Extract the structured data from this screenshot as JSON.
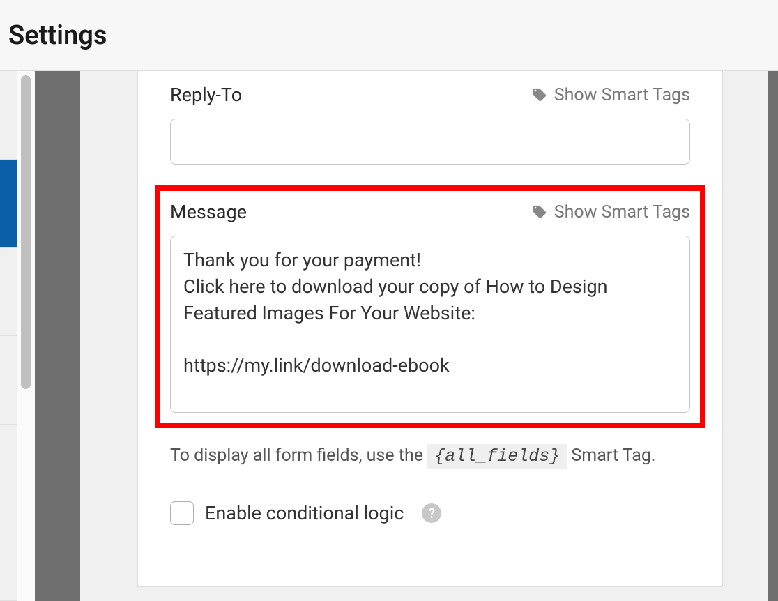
{
  "header": {
    "title": "Settings"
  },
  "fields": {
    "reply_to": {
      "label": "Reply-To",
      "smart_tags_label": "Show Smart Tags",
      "value": ""
    },
    "message": {
      "label": "Message",
      "smart_tags_label": "Show Smart Tags",
      "value": "Thank you for your payment!\nClick here to download your copy of How to Design Featured Images For Your Website:\n\nhttps://my.link/download-ebook"
    }
  },
  "helper": {
    "prefix": "To display all form fields, use the ",
    "code": "{all_fields}",
    "suffix": " Smart Tag."
  },
  "conditional": {
    "label": "Enable conditional logic",
    "checked": false
  }
}
